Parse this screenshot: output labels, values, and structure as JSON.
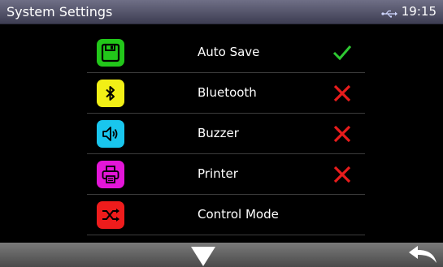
{
  "header": {
    "title": "System Settings",
    "time": "19:15",
    "usb_icon": "usb-icon"
  },
  "settings": [
    {
      "label": "Auto Save",
      "icon": "save-icon",
      "icon_color": "#22c71a",
      "state": "enabled"
    },
    {
      "label": "Bluetooth",
      "icon": "bluetooth-icon",
      "icon_color": "#f2ef16",
      "state": "disabled"
    },
    {
      "label": "Buzzer",
      "icon": "speaker-icon",
      "icon_color": "#19c6ee",
      "state": "disabled"
    },
    {
      "label": "Printer",
      "icon": "printer-icon",
      "icon_color": "#e316d8",
      "state": "disabled"
    },
    {
      "label": "Control Mode",
      "icon": "shuffle-icon",
      "icon_color": "#ee1c1c",
      "state": "none"
    }
  ],
  "footer": {
    "down_icon": "down-arrow-icon",
    "back_icon": "back-arrow-icon"
  },
  "colors": {
    "check": "#2ec832",
    "cross": "#e81c1c"
  }
}
